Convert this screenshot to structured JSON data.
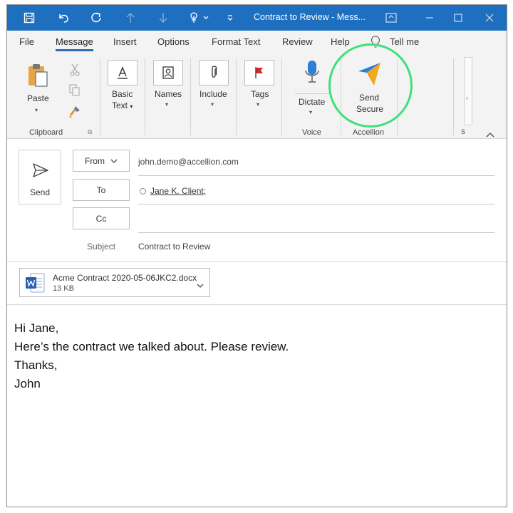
{
  "window": {
    "title": "Contract to Review - Mess..."
  },
  "quick_access": {
    "icons": [
      "save-icon",
      "undo-icon",
      "redo-icon",
      "up-arrow-icon",
      "down-arrow-icon",
      "touch-mode-icon",
      "customize-icon"
    ]
  },
  "tabs": [
    {
      "label": "File"
    },
    {
      "label": "Message"
    },
    {
      "label": "Insert"
    },
    {
      "label": "Options"
    },
    {
      "label": "Format Text"
    },
    {
      "label": "Review"
    },
    {
      "label": "Help"
    }
  ],
  "tell_me": "Tell me",
  "ribbon": {
    "clipboard": {
      "paste": "Paste",
      "group": "Clipboard"
    },
    "basic_text": {
      "line1": "Basic",
      "line2": "Text"
    },
    "names": "Names",
    "include": "Include",
    "tags": "Tags",
    "voice": {
      "dictate": "Dictate",
      "group": "Voice"
    },
    "accellion": {
      "line1": "Send",
      "line2": "Secure",
      "group": "Accellion"
    },
    "partial_group": "S"
  },
  "compose": {
    "send": "Send",
    "from_label": "From",
    "from_value": "john.demo@accellion.com",
    "to_label": "To",
    "to_value": "Jane K. Client;",
    "cc_label": "Cc",
    "subject_label": "Subject",
    "subject_value": "Contract to Review"
  },
  "attachment": {
    "name": "Acme Contract 2020-05-06JKC2.docx",
    "size": "13 KB",
    "icon": "word-doc-icon"
  },
  "body": {
    "lines": [
      "Hi Jane,",
      "Here’s the contract we talked about. Please review.",
      "Thanks,",
      "John"
    ]
  },
  "colors": {
    "titlebar": "#1e6fbf",
    "highlight": "#3ee07a",
    "active_tab": "#2b6cb5"
  }
}
